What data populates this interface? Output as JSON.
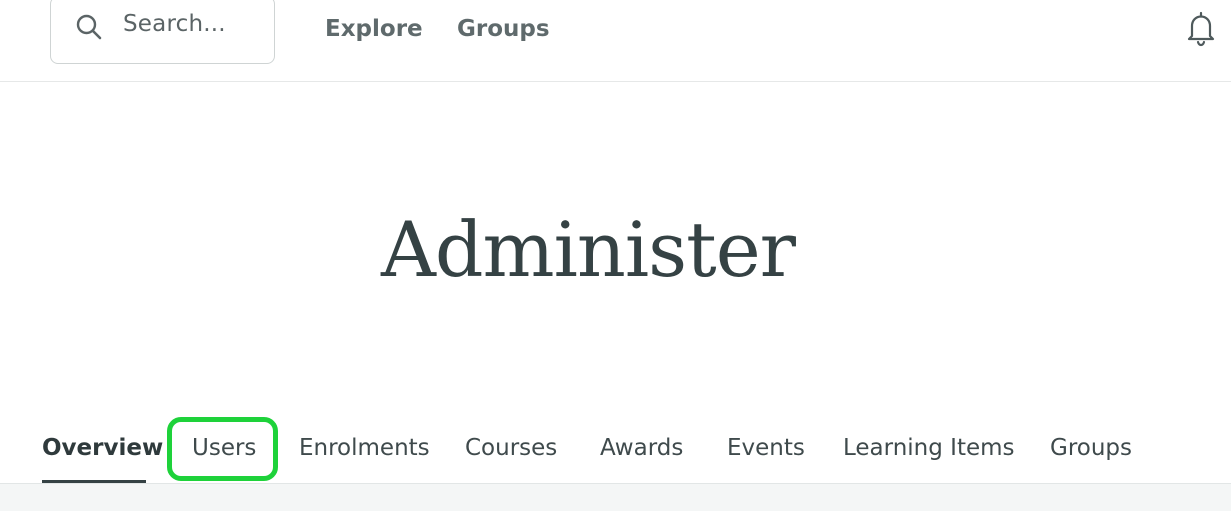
{
  "header": {
    "search": {
      "placeholder": "Search..."
    },
    "nav": [
      {
        "label": "Explore"
      },
      {
        "label": "Groups"
      }
    ],
    "notifications_icon": "bell-icon"
  },
  "page": {
    "title": "Administer"
  },
  "tabs": [
    {
      "label": "Overview",
      "active": true
    },
    {
      "label": "Users",
      "active": false,
      "highlighted": true
    },
    {
      "label": "Enrolments",
      "active": false
    },
    {
      "label": "Courses",
      "active": false
    },
    {
      "label": "Awards",
      "active": false
    },
    {
      "label": "Events",
      "active": false
    },
    {
      "label": "Learning Items",
      "active": false
    },
    {
      "label": "Groups",
      "active": false
    }
  ],
  "colors": {
    "highlight": "#1ed23a",
    "active_tab_underline": "#354244",
    "title": "#354244"
  }
}
